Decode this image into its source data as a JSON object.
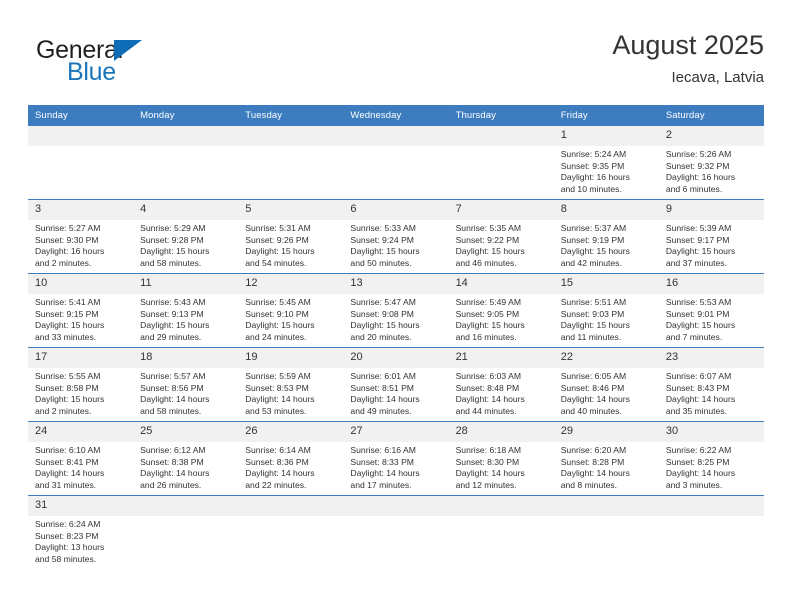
{
  "brand": {
    "name_top": "General",
    "name_bottom": "Blue",
    "triangle_color": "#0f6cb6",
    "text_color": "#1b75bb"
  },
  "header": {
    "title": "August 2025",
    "subtitle": "Iecava, Latvia"
  },
  "theme": {
    "header_blue": "#3c7cbf",
    "daynum_band": "#f1f1f1",
    "text": "#333333"
  },
  "weekday_headers": [
    "Sunday",
    "Monday",
    "Tuesday",
    "Wednesday",
    "Thursday",
    "Friday",
    "Saturday"
  ],
  "weeks": [
    [
      {
        "day": "",
        "blank": true
      },
      {
        "day": "",
        "blank": true
      },
      {
        "day": "",
        "blank": true
      },
      {
        "day": "",
        "blank": true
      },
      {
        "day": "",
        "blank": true
      },
      {
        "day": "1",
        "sunrise": "Sunrise: 5:24 AM",
        "sunset": "Sunset: 9:35 PM",
        "daylight1": "Daylight: 16 hours",
        "daylight2": "and 10 minutes."
      },
      {
        "day": "2",
        "sunrise": "Sunrise: 5:26 AM",
        "sunset": "Sunset: 9:32 PM",
        "daylight1": "Daylight: 16 hours",
        "daylight2": "and 6 minutes."
      }
    ],
    [
      {
        "day": "3",
        "sunrise": "Sunrise: 5:27 AM",
        "sunset": "Sunset: 9:30 PM",
        "daylight1": "Daylight: 16 hours",
        "daylight2": "and 2 minutes."
      },
      {
        "day": "4",
        "sunrise": "Sunrise: 5:29 AM",
        "sunset": "Sunset: 9:28 PM",
        "daylight1": "Daylight: 15 hours",
        "daylight2": "and 58 minutes."
      },
      {
        "day": "5",
        "sunrise": "Sunrise: 5:31 AM",
        "sunset": "Sunset: 9:26 PM",
        "daylight1": "Daylight: 15 hours",
        "daylight2": "and 54 minutes."
      },
      {
        "day": "6",
        "sunrise": "Sunrise: 5:33 AM",
        "sunset": "Sunset: 9:24 PM",
        "daylight1": "Daylight: 15 hours",
        "daylight2": "and 50 minutes."
      },
      {
        "day": "7",
        "sunrise": "Sunrise: 5:35 AM",
        "sunset": "Sunset: 9:22 PM",
        "daylight1": "Daylight: 15 hours",
        "daylight2": "and 46 minutes."
      },
      {
        "day": "8",
        "sunrise": "Sunrise: 5:37 AM",
        "sunset": "Sunset: 9:19 PM",
        "daylight1": "Daylight: 15 hours",
        "daylight2": "and 42 minutes."
      },
      {
        "day": "9",
        "sunrise": "Sunrise: 5:39 AM",
        "sunset": "Sunset: 9:17 PM",
        "daylight1": "Daylight: 15 hours",
        "daylight2": "and 37 minutes."
      }
    ],
    [
      {
        "day": "10",
        "sunrise": "Sunrise: 5:41 AM",
        "sunset": "Sunset: 9:15 PM",
        "daylight1": "Daylight: 15 hours",
        "daylight2": "and 33 minutes."
      },
      {
        "day": "11",
        "sunrise": "Sunrise: 5:43 AM",
        "sunset": "Sunset: 9:13 PM",
        "daylight1": "Daylight: 15 hours",
        "daylight2": "and 29 minutes."
      },
      {
        "day": "12",
        "sunrise": "Sunrise: 5:45 AM",
        "sunset": "Sunset: 9:10 PM",
        "daylight1": "Daylight: 15 hours",
        "daylight2": "and 24 minutes."
      },
      {
        "day": "13",
        "sunrise": "Sunrise: 5:47 AM",
        "sunset": "Sunset: 9:08 PM",
        "daylight1": "Daylight: 15 hours",
        "daylight2": "and 20 minutes."
      },
      {
        "day": "14",
        "sunrise": "Sunrise: 5:49 AM",
        "sunset": "Sunset: 9:05 PM",
        "daylight1": "Daylight: 15 hours",
        "daylight2": "and 16 minutes."
      },
      {
        "day": "15",
        "sunrise": "Sunrise: 5:51 AM",
        "sunset": "Sunset: 9:03 PM",
        "daylight1": "Daylight: 15 hours",
        "daylight2": "and 11 minutes."
      },
      {
        "day": "16",
        "sunrise": "Sunrise: 5:53 AM",
        "sunset": "Sunset: 9:01 PM",
        "daylight1": "Daylight: 15 hours",
        "daylight2": "and 7 minutes."
      }
    ],
    [
      {
        "day": "17",
        "sunrise": "Sunrise: 5:55 AM",
        "sunset": "Sunset: 8:58 PM",
        "daylight1": "Daylight: 15 hours",
        "daylight2": "and 2 minutes."
      },
      {
        "day": "18",
        "sunrise": "Sunrise: 5:57 AM",
        "sunset": "Sunset: 8:56 PM",
        "daylight1": "Daylight: 14 hours",
        "daylight2": "and 58 minutes."
      },
      {
        "day": "19",
        "sunrise": "Sunrise: 5:59 AM",
        "sunset": "Sunset: 8:53 PM",
        "daylight1": "Daylight: 14 hours",
        "daylight2": "and 53 minutes."
      },
      {
        "day": "20",
        "sunrise": "Sunrise: 6:01 AM",
        "sunset": "Sunset: 8:51 PM",
        "daylight1": "Daylight: 14 hours",
        "daylight2": "and 49 minutes."
      },
      {
        "day": "21",
        "sunrise": "Sunrise: 6:03 AM",
        "sunset": "Sunset: 8:48 PM",
        "daylight1": "Daylight: 14 hours",
        "daylight2": "and 44 minutes."
      },
      {
        "day": "22",
        "sunrise": "Sunrise: 6:05 AM",
        "sunset": "Sunset: 8:46 PM",
        "daylight1": "Daylight: 14 hours",
        "daylight2": "and 40 minutes."
      },
      {
        "day": "23",
        "sunrise": "Sunrise: 6:07 AM",
        "sunset": "Sunset: 8:43 PM",
        "daylight1": "Daylight: 14 hours",
        "daylight2": "and 35 minutes."
      }
    ],
    [
      {
        "day": "24",
        "sunrise": "Sunrise: 6:10 AM",
        "sunset": "Sunset: 8:41 PM",
        "daylight1": "Daylight: 14 hours",
        "daylight2": "and 31 minutes."
      },
      {
        "day": "25",
        "sunrise": "Sunrise: 6:12 AM",
        "sunset": "Sunset: 8:38 PM",
        "daylight1": "Daylight: 14 hours",
        "daylight2": "and 26 minutes."
      },
      {
        "day": "26",
        "sunrise": "Sunrise: 6:14 AM",
        "sunset": "Sunset: 8:36 PM",
        "daylight1": "Daylight: 14 hours",
        "daylight2": "and 22 minutes."
      },
      {
        "day": "27",
        "sunrise": "Sunrise: 6:16 AM",
        "sunset": "Sunset: 8:33 PM",
        "daylight1": "Daylight: 14 hours",
        "daylight2": "and 17 minutes."
      },
      {
        "day": "28",
        "sunrise": "Sunrise: 6:18 AM",
        "sunset": "Sunset: 8:30 PM",
        "daylight1": "Daylight: 14 hours",
        "daylight2": "and 12 minutes."
      },
      {
        "day": "29",
        "sunrise": "Sunrise: 6:20 AM",
        "sunset": "Sunset: 8:28 PM",
        "daylight1": "Daylight: 14 hours",
        "daylight2": "and 8 minutes."
      },
      {
        "day": "30",
        "sunrise": "Sunrise: 6:22 AM",
        "sunset": "Sunset: 8:25 PM",
        "daylight1": "Daylight: 14 hours",
        "daylight2": "and 3 minutes."
      }
    ],
    [
      {
        "day": "31",
        "sunrise": "Sunrise: 6:24 AM",
        "sunset": "Sunset: 8:23 PM",
        "daylight1": "Daylight: 13 hours",
        "daylight2": "and 58 minutes."
      },
      {
        "day": "",
        "blank": true
      },
      {
        "day": "",
        "blank": true
      },
      {
        "day": "",
        "blank": true
      },
      {
        "day": "",
        "blank": true
      },
      {
        "day": "",
        "blank": true
      },
      {
        "day": "",
        "blank": true
      }
    ]
  ]
}
